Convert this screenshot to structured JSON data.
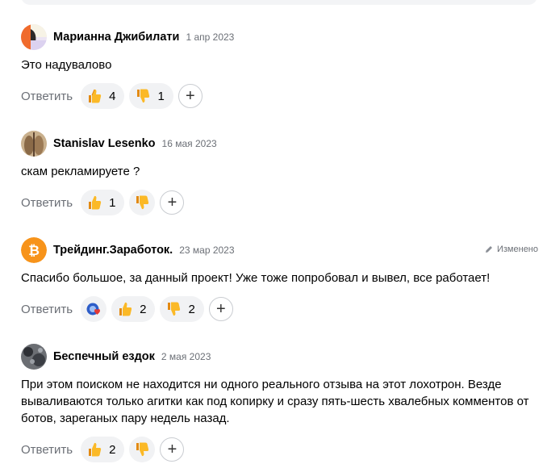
{
  "reply_label": "Ответить",
  "edited_label": "Изменено",
  "comments": [
    {
      "author": "Марианна Джибилати",
      "date": "1 апр 2023",
      "text": "Это надувалово",
      "likes": "4",
      "dislikes": "1"
    },
    {
      "author": "Stanislav Lesenko",
      "date": "16 мая 2023",
      "text": "скам рекламируете ?",
      "likes": "1",
      "dislikes": ""
    },
    {
      "author": "Трейдинг.Заработок.",
      "date": "23 мар 2023",
      "text": "Спасибо большое, за данный проект! Уже тоже попробовал и вывел, все работает!",
      "likes": "2",
      "dislikes": "2"
    },
    {
      "author": "Беспечный ездок",
      "date": "2 мая 2023",
      "text": "При этом поиском не находится ни одного реального отзыва на этот лохотрон. Везде вываливаются только агитки как под копирку и сразу пять-шесть хвалебных комментов от ботов, зареганых пару недель назад.",
      "likes": "2",
      "dislikes": ""
    }
  ],
  "icons": {
    "like": "thumbs-up-emoji",
    "dislike": "thumbs-down-emoji",
    "add": "plus-icon",
    "edit": "pencil-icon",
    "reaction": "heart-badge-emoji"
  },
  "colors": {
    "muted_text": "#6b6f76",
    "pill_bg": "#f1f2f4",
    "bitcoin": "#f7931a"
  }
}
